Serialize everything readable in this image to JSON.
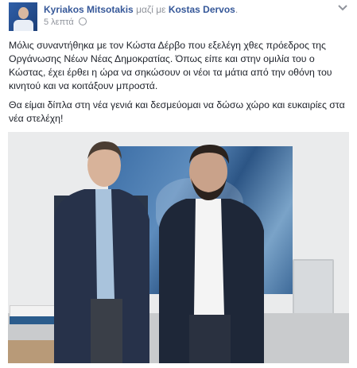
{
  "post": {
    "author": "Kyriakos Mitsotakis",
    "with_text": "μαζί με",
    "tagged": "Kostas Dervos",
    "tagged_suffix": ".",
    "timestamp": "5 λεπτά",
    "paragraphs": [
      "Μόλις συναντήθηκα με τον Κώστα Δέρβο που εξελέγη χθες πρόεδρος της Οργάνωσης Νέων Νέας Δημοκρατίας. Όπως είπε και στην ομιλία του ο Κώστας, έχει έρθει η ώρα να σηκώσουν οι νέοι τα μάτια από την οθόνη του κινητού και να κοιτάξουν μπροστά.",
      "Θα είμαι δίπλα στη νέα γενιά και δεσμεύομαι να δώσω χώρο και ευκαιρίες στα νέα στελέχη!"
    ],
    "menu_icon": "chevron-down-icon",
    "privacy_icon": "globe-icon"
  },
  "colors": {
    "link": "#365899",
    "text": "#1d2129",
    "meta": "#90949c"
  }
}
